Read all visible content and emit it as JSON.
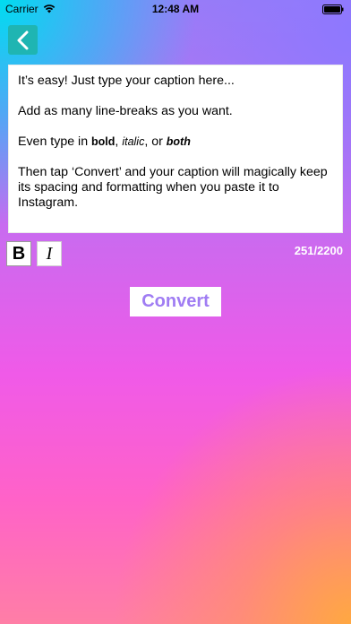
{
  "status_bar": {
    "carrier": "Carrier",
    "time": "12:48 AM",
    "wifi_icon": "wifi-icon",
    "battery_icon": "battery-icon"
  },
  "nav": {
    "back_icon": "chevron-left-icon",
    "back_color": "#1fb5b2"
  },
  "caption": {
    "line1": "It’s easy! Just type your caption here...",
    "line2": "Add as many line-breaks as you want.",
    "line3_prefix": "Even type in ",
    "line3_bold": "bold",
    "line3_sep1": ", ",
    "line3_italic": "italic",
    "line3_sep2": ", or ",
    "line3_both": "both",
    "line4": "Then tap ‘Convert’ and your caption will magically keep its spacing and formatting when you paste it to Instagram."
  },
  "format": {
    "bold_label": "B",
    "italic_label": "I"
  },
  "char_count": "251/2200",
  "convert_label": "Convert",
  "colors": {
    "accent": "#a07df3",
    "back_button": "#1fb5b2"
  }
}
